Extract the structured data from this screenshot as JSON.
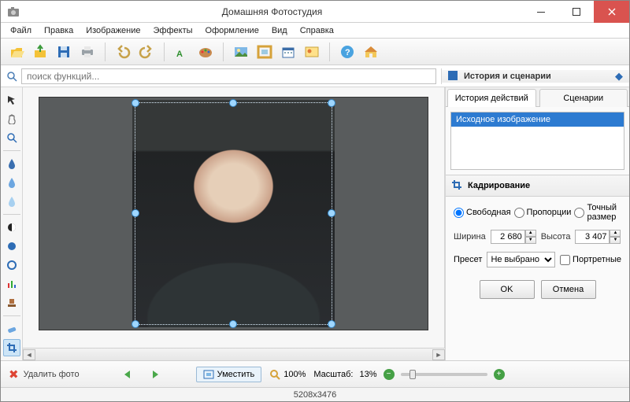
{
  "window": {
    "title": "Домашняя Фотостудия"
  },
  "menu": [
    "Файл",
    "Правка",
    "Изображение",
    "Эффекты",
    "Оформление",
    "Вид",
    "Справка"
  ],
  "search": {
    "placeholder": "поиск функций..."
  },
  "history": {
    "panel_title": "История и сценарии",
    "tabs": [
      "История действий",
      "Сценарии"
    ],
    "active_tab": 0,
    "items": [
      "Исходное изображение"
    ],
    "selected": 0
  },
  "crop": {
    "panel_title": "Кадрирование",
    "modes": {
      "free": "Свободная",
      "prop": "Пропорции",
      "exact": "Точный размер",
      "selected": "free"
    },
    "width_label": "Ширина",
    "width_value": "2 680",
    "height_label": "Высота",
    "height_value": "3 407",
    "preset_label": "Пресет",
    "preset_value": "Не выбрано",
    "portrait_label": "Портретные",
    "ok": "OK",
    "cancel": "Отмена"
  },
  "bottom": {
    "delete": "Удалить фото",
    "fit": "Уместить",
    "zoom100": "100%",
    "scale_label": "Масштаб:",
    "scale_value": "13%"
  },
  "status": {
    "dimensions": "5208x3476"
  },
  "colors": {
    "accent": "#2d7bd1",
    "crop_handle": "#9fd7ff"
  }
}
